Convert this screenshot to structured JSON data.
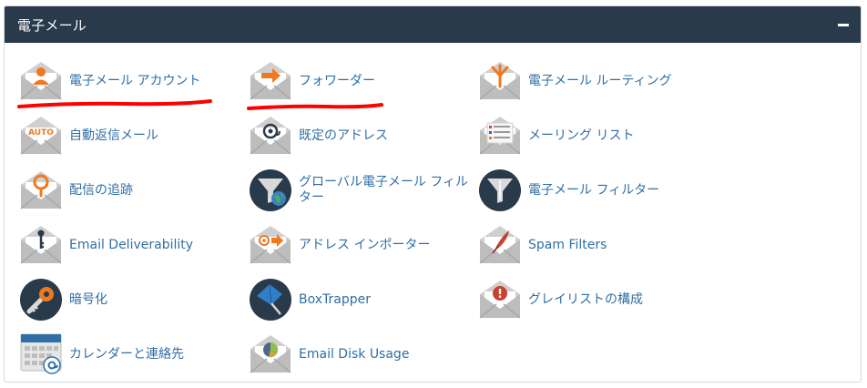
{
  "panel": {
    "title": "電子メール"
  },
  "items": [
    {
      "label": "電子メール アカウント"
    },
    {
      "label": "フォワーダー"
    },
    {
      "label": "電子メール ルーティング"
    },
    {
      "label": "自動返信メール"
    },
    {
      "label": "既定のアドレス"
    },
    {
      "label": "メーリング リスト"
    },
    {
      "label": "配信の追跡"
    },
    {
      "label": "グローバル電子メール フィルター"
    },
    {
      "label": "電子メール フィルター"
    },
    {
      "label": "Email Deliverability"
    },
    {
      "label": "アドレス インポーター"
    },
    {
      "label": "Spam Filters"
    },
    {
      "label": "暗号化"
    },
    {
      "label": "BoxTrapper"
    },
    {
      "label": "グレイリストの構成"
    },
    {
      "label": "カレンダーと連絡先"
    },
    {
      "label": "Email Disk Usage"
    }
  ],
  "icon_badges": {
    "auto": "AUTO"
  },
  "colors": {
    "header_bg": "#293a4a",
    "link": "#2f6fa6",
    "accent_orange": "#f0781e",
    "annotation_red": "#ff0000"
  }
}
